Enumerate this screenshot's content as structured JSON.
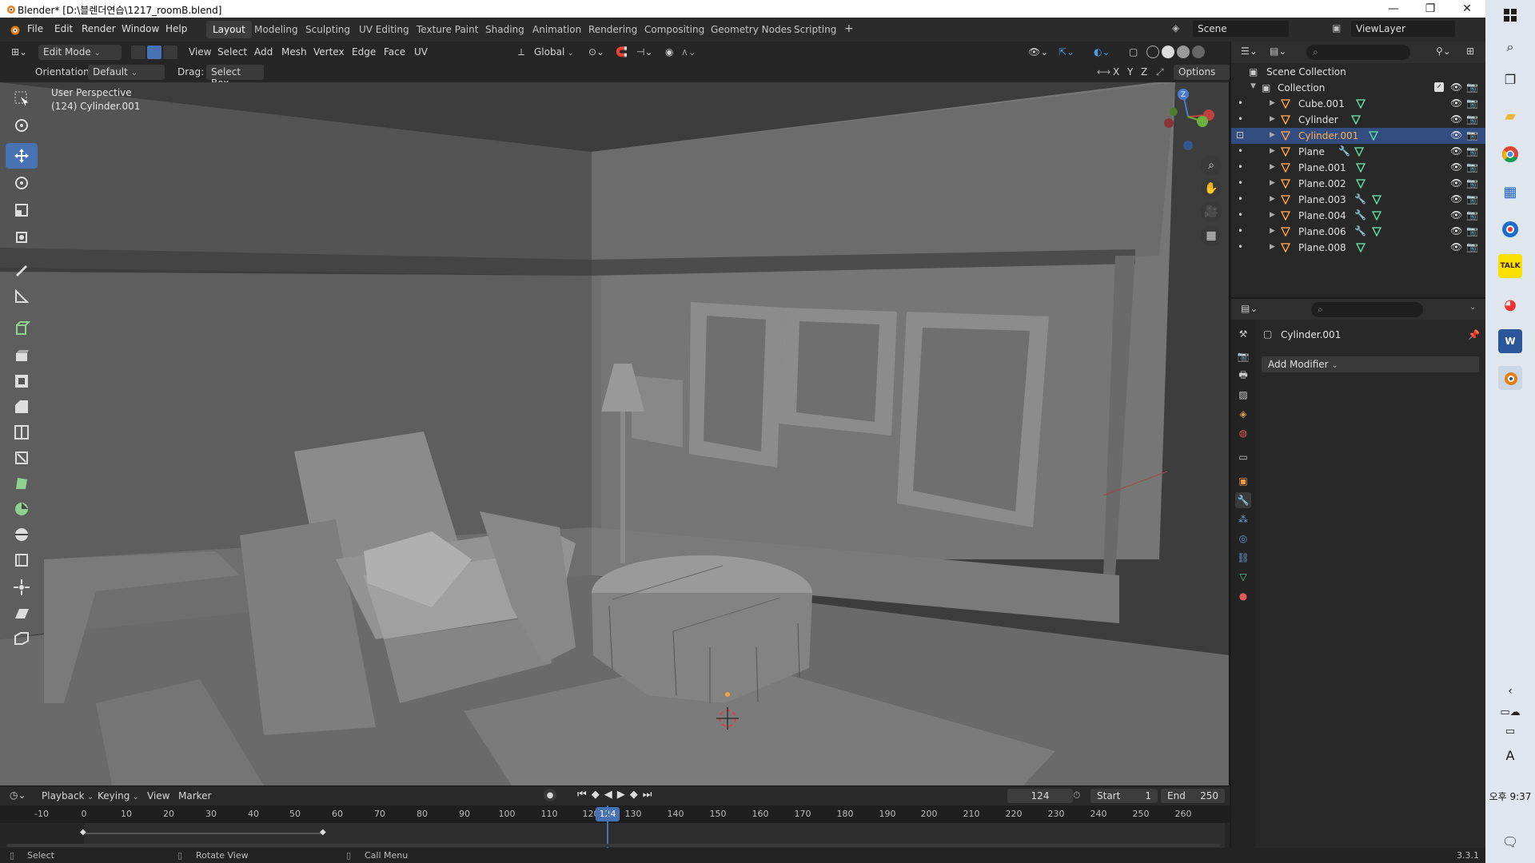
{
  "window": {
    "title": "Blender* [D:\\블렌더연습\\1217_roomB.blend]",
    "minimize": "—",
    "maximize": "❐",
    "close": "✕"
  },
  "menu": [
    "File",
    "Edit",
    "Render",
    "Window",
    "Help"
  ],
  "workspaces": [
    "Layout",
    "Modeling",
    "Sculpting",
    "UV Editing",
    "Texture Paint",
    "Shading",
    "Animation",
    "Rendering",
    "Compositing",
    "Geometry Nodes",
    "Scripting"
  ],
  "active_workspace": "Layout",
  "add_workspace": "+",
  "scene": {
    "label": "Scene",
    "view_layer": "ViewLayer"
  },
  "viewport_header": {
    "mode": "Edit Mode",
    "menus": [
      "View",
      "Select",
      "Add",
      "Mesh",
      "Vertex",
      "Edge",
      "Face",
      "UV"
    ],
    "transform_orientation": "Global"
  },
  "tool_header": {
    "orientation_label": "Orientation:",
    "orientation_value": "Default",
    "drag_label": "Drag:",
    "drag_value": "Select Box",
    "axes": [
      "X",
      "Y",
      "Z"
    ],
    "options": "Options"
  },
  "viewport": {
    "perspective": "User Perspective",
    "object_info": "(124) Cylinder.001",
    "gizmo_axes": {
      "z": "Z"
    }
  },
  "timeline": {
    "menus": [
      "Playback",
      "Keying",
      "View",
      "Marker"
    ],
    "current_frame": "124",
    "start_label": "Start",
    "start_value": "1",
    "end_label": "End",
    "end_value": "250",
    "ruler": [
      "-10",
      "0",
      "10",
      "20",
      "30",
      "40",
      "50",
      "60",
      "70",
      "80",
      "90",
      "100",
      "110",
      "120",
      "130",
      "140",
      "150",
      "160",
      "170",
      "180",
      "190",
      "200",
      "210",
      "220",
      "230",
      "240",
      "250",
      "260"
    ]
  },
  "statusbar": {
    "select": "Select",
    "rotate": "Rotate View",
    "call_menu": "Call Menu",
    "version": "3.3.1"
  },
  "outliner": {
    "scene_collection": "Scene Collection",
    "collection": "Collection",
    "objects": [
      {
        "name": "Cube.001",
        "modifier": false,
        "selected": false
      },
      {
        "name": "Cylinder",
        "modifier": false,
        "selected": false
      },
      {
        "name": "Cylinder.001",
        "modifier": false,
        "selected": true
      },
      {
        "name": "Plane",
        "modifier": true,
        "selected": false
      },
      {
        "name": "Plane.001",
        "modifier": false,
        "selected": false
      },
      {
        "name": "Plane.002",
        "modifier": false,
        "selected": false
      },
      {
        "name": "Plane.003",
        "modifier": true,
        "selected": false
      },
      {
        "name": "Plane.004",
        "modifier": true,
        "selected": false
      },
      {
        "name": "Plane.006",
        "modifier": true,
        "selected": false
      },
      {
        "name": "Plane.008",
        "modifier": false,
        "selected": false
      }
    ]
  },
  "properties": {
    "object_name": "Cylinder.001",
    "add_modifier": "Add Modifier"
  },
  "taskbar": {
    "time_period": "오후",
    "time": "9:37",
    "ime": "A"
  },
  "colors": {
    "accent": "#4772b3",
    "selected_row": "#334d80",
    "selected_text": "#ffb04d",
    "playhead": "#4772b3"
  }
}
